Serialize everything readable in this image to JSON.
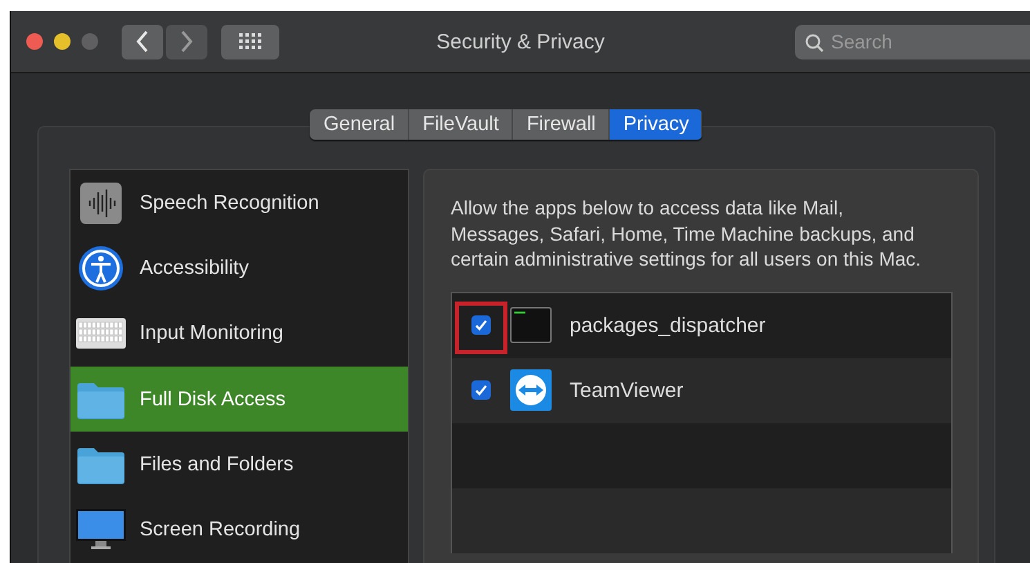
{
  "window": {
    "title": "Security & Privacy"
  },
  "search": {
    "placeholder": "Search"
  },
  "tabs": [
    {
      "label": "General",
      "selected": false
    },
    {
      "label": "FileVault",
      "selected": false
    },
    {
      "label": "Firewall",
      "selected": false
    },
    {
      "label": "Privacy",
      "selected": true
    }
  ],
  "sidebar": {
    "items": [
      {
        "label": "Speech Recognition",
        "kind": "speech",
        "selected": false
      },
      {
        "label": "Accessibility",
        "kind": "accessibility",
        "selected": false
      },
      {
        "label": "Input Monitoring",
        "kind": "keyboard",
        "selected": false
      },
      {
        "label": "Full Disk Access",
        "kind": "folder",
        "selected": true
      },
      {
        "label": "Files and Folders",
        "kind": "folder",
        "selected": false
      },
      {
        "label": "Screen Recording",
        "kind": "display",
        "selected": false
      }
    ]
  },
  "description": "Allow the apps below to access data like Mail, Messages, Safari, Home, Time Machine backups, and certain administrative settings for all users on this Mac.",
  "apps": [
    {
      "name": "packages_dispatcher",
      "kind": "terminal",
      "checked": true,
      "highlighted": true
    },
    {
      "name": "TeamViewer",
      "kind": "teamviewer",
      "checked": true,
      "highlighted": false
    }
  ]
}
